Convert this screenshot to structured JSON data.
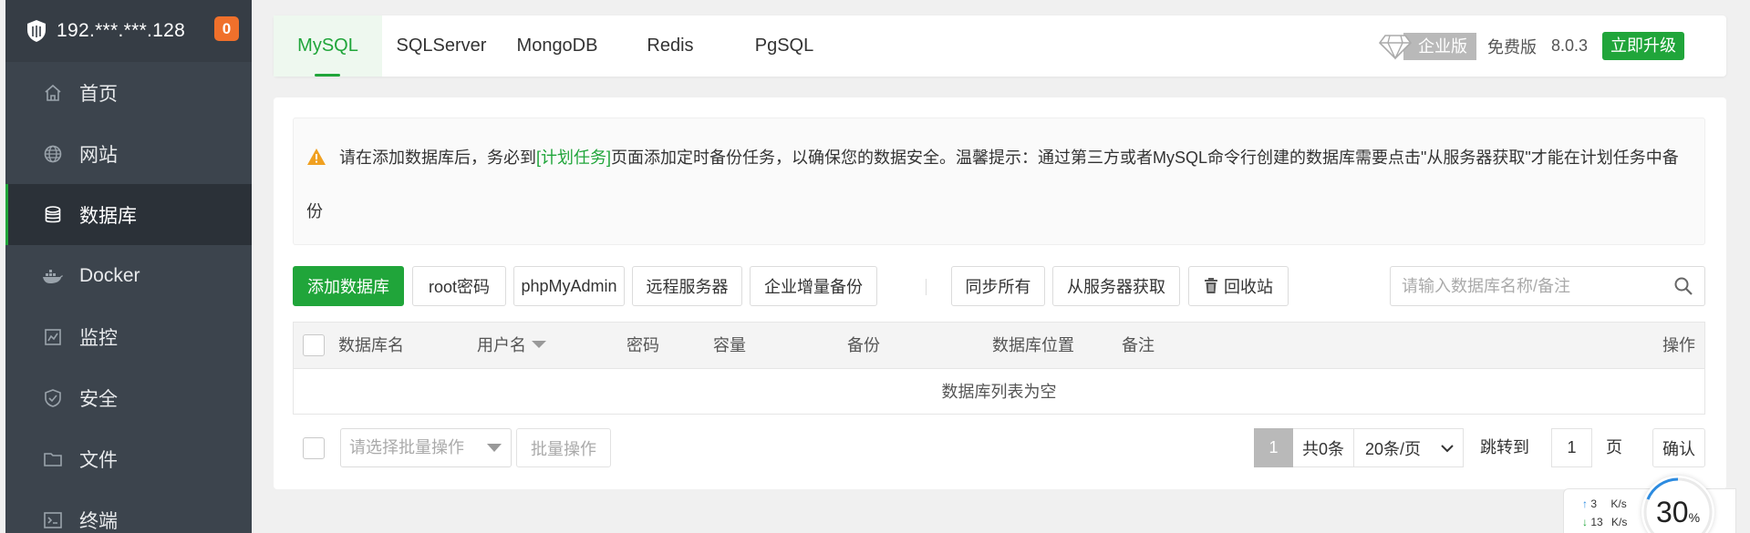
{
  "sidebar": {
    "server_ip": "192.***.***.128",
    "badge_count": "0",
    "items": [
      {
        "label": "首页",
        "icon": "home-icon"
      },
      {
        "label": "网站",
        "icon": "globe-icon"
      },
      {
        "label": "数据库",
        "icon": "database-icon",
        "active": true
      },
      {
        "label": "Docker",
        "icon": "docker-icon"
      },
      {
        "label": "监控",
        "icon": "monitor-chart-icon"
      },
      {
        "label": "安全",
        "icon": "shield-check-icon"
      },
      {
        "label": "文件",
        "icon": "folder-icon"
      },
      {
        "label": "终端",
        "icon": "terminal-icon"
      }
    ]
  },
  "tabs": [
    "MySQL",
    "SQLServer",
    "MongoDB",
    "Redis",
    "PgSQL"
  ],
  "edition": {
    "enterprise_label": "企业版",
    "free_label": "免费版",
    "version": "8.0.3",
    "upgrade_label": "立即升级"
  },
  "alert": {
    "text_before": "请在添加数据库后，务必到",
    "link_text": "[计划任务]",
    "text_after": "页面添加定时备份任务，以确保您的数据安全。温馨提示：通过第三方或者MySQL命令行创建的数据库需要点击\"从服务器获取\"才能在计划任务中备",
    "text_wrap": "份"
  },
  "toolbar": {
    "add_db": "添加数据库",
    "root_password": "root密码",
    "phpmyadmin": "phpMyAdmin",
    "remote_server": "远程服务器",
    "enterprise_backup": "企业增量备份",
    "sync_all": "同步所有",
    "fetch_from_server": "从服务器获取",
    "recycle_bin": "回收站"
  },
  "search": {
    "placeholder": "请输入数据库名称/备注"
  },
  "table": {
    "columns": [
      "数据库名",
      "用户名",
      "密码",
      "容量",
      "备份",
      "数据库位置",
      "备注",
      "操作"
    ],
    "empty_text": "数据库列表为空"
  },
  "batch": {
    "select_placeholder": "请选择批量操作",
    "batch_button": "批量操作"
  },
  "pagination": {
    "current_page": "1",
    "total": "共0条",
    "per_page": "20条/页",
    "jump_label": "跳转到",
    "jump_value": "1",
    "page_unit": "页",
    "confirm": "确认"
  },
  "network": {
    "up_value": "3",
    "up_unit": "K/s",
    "down_value": "13",
    "down_unit": "K/s",
    "cpu_percent": "30",
    "percent_sign": "%"
  },
  "colors": {
    "accent": "#20a53a",
    "sidebar_bg": "#3c444d",
    "badge": "#f0702b"
  }
}
